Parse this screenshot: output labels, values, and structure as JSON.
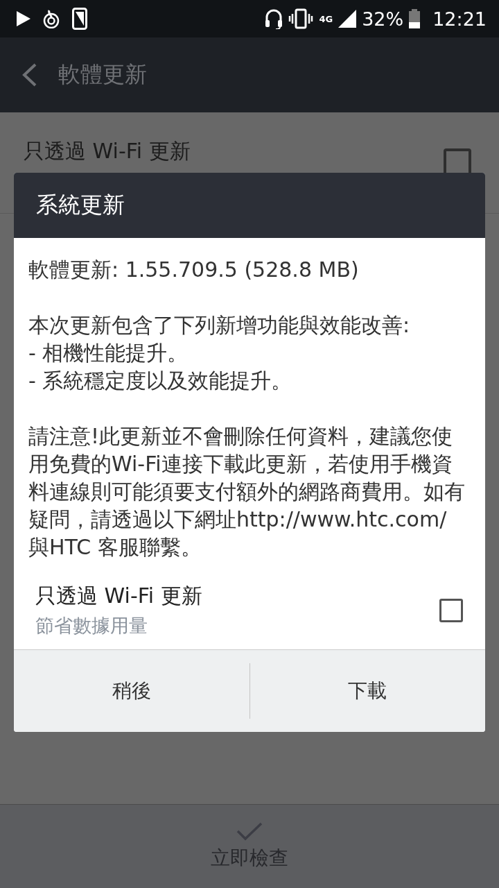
{
  "status_bar": {
    "network": "4G",
    "battery_percent": "32%",
    "time": "12:21"
  },
  "app_bar": {
    "title": "軟體更新"
  },
  "settings": [
    {
      "title": "只透過 Wi-Fi 更新",
      "checked": false
    }
  ],
  "bottom_action": {
    "label": "立即檢查"
  },
  "dialog": {
    "title": "系統更新",
    "version_line": "軟體更新: 1.55.709.5 (528.8 MB)",
    "changes": "本次更新包含了下列新增功能與效能改善:\n- 相機性能提升。\n- 系統穩定度以及效能提升。",
    "notice": {
      "text_before": "請注意!此更新並不會刪除任何資料，建議您使用免費的Wi-Fi連接下載此更新，若使用手機資料連線則可能須要支付額外的網路商費用。如有疑問，請透過以下網址",
      "link": "http://www.htc.com/",
      "text_after": "  與HTC 客服聯繫。"
    },
    "option": {
      "title": "只透過 Wi-Fi 更新",
      "subtitle": "節省數據用量",
      "checked": false
    },
    "buttons": [
      "稍後",
      "下載"
    ]
  }
}
